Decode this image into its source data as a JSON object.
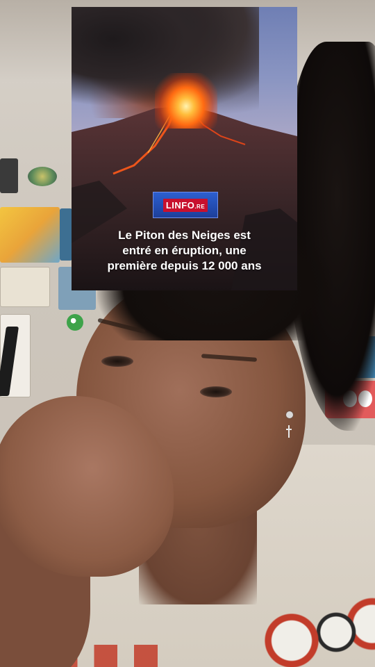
{
  "news_card": {
    "brand": {
      "logo_text": "LINFO",
      "logo_suffix": ".RE",
      "brand_color": "#c8102e",
      "badge_color": "#1d3f9a"
    },
    "headline_lines": [
      "Le Piton des Neiges est",
      "entré en éruption, une",
      "première depuis 12 000 ans"
    ],
    "image_subject": "volcano-eruption"
  }
}
